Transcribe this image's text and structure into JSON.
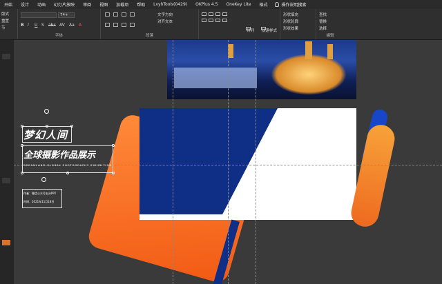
{
  "menu": [
    "开始",
    "设计",
    "动画",
    "幻灯片放映",
    "审阅",
    "视图",
    "加载项",
    "帮助",
    "LvyhTools(0429)",
    "OKPlus 4.5",
    "OneKey Lite",
    "格式",
    "操作说明搜索"
  ],
  "ribbon": {
    "font_size": "74+",
    "group_font": "字体",
    "group_paragraph": "段落",
    "group_edit": "编辑",
    "text_direction": "文字方向",
    "align_text": "对齐文本",
    "arrange": "排列",
    "quick_style": "快速样式",
    "shape_fill": "形状填充",
    "shape_outline": "形状轮廓",
    "shape_effect": "形状效果",
    "find": "查找",
    "replace": "替换",
    "select": "选择",
    "format_buttons": [
      "B",
      "I",
      "U",
      "S",
      "abc",
      "AV",
      "Aa",
      "A"
    ]
  },
  "left_labels": [
    "版式",
    "重置",
    "节"
  ],
  "slide": {
    "title_line1": "梦幻人间",
    "title_line2": "全球摄影作品展示",
    "subtitle": "DREAMLAND GLOBAL PHOTOGRAPHY EXHIBITION",
    "author_line": "作者：微信公众号五分PPT",
    "date_line": "时间：2021年11月18日"
  },
  "colors": {
    "accent_orange": "#f26a1f",
    "accent_blue": "#0f2f86",
    "ribbon_bg": "#2f2f2f"
  }
}
